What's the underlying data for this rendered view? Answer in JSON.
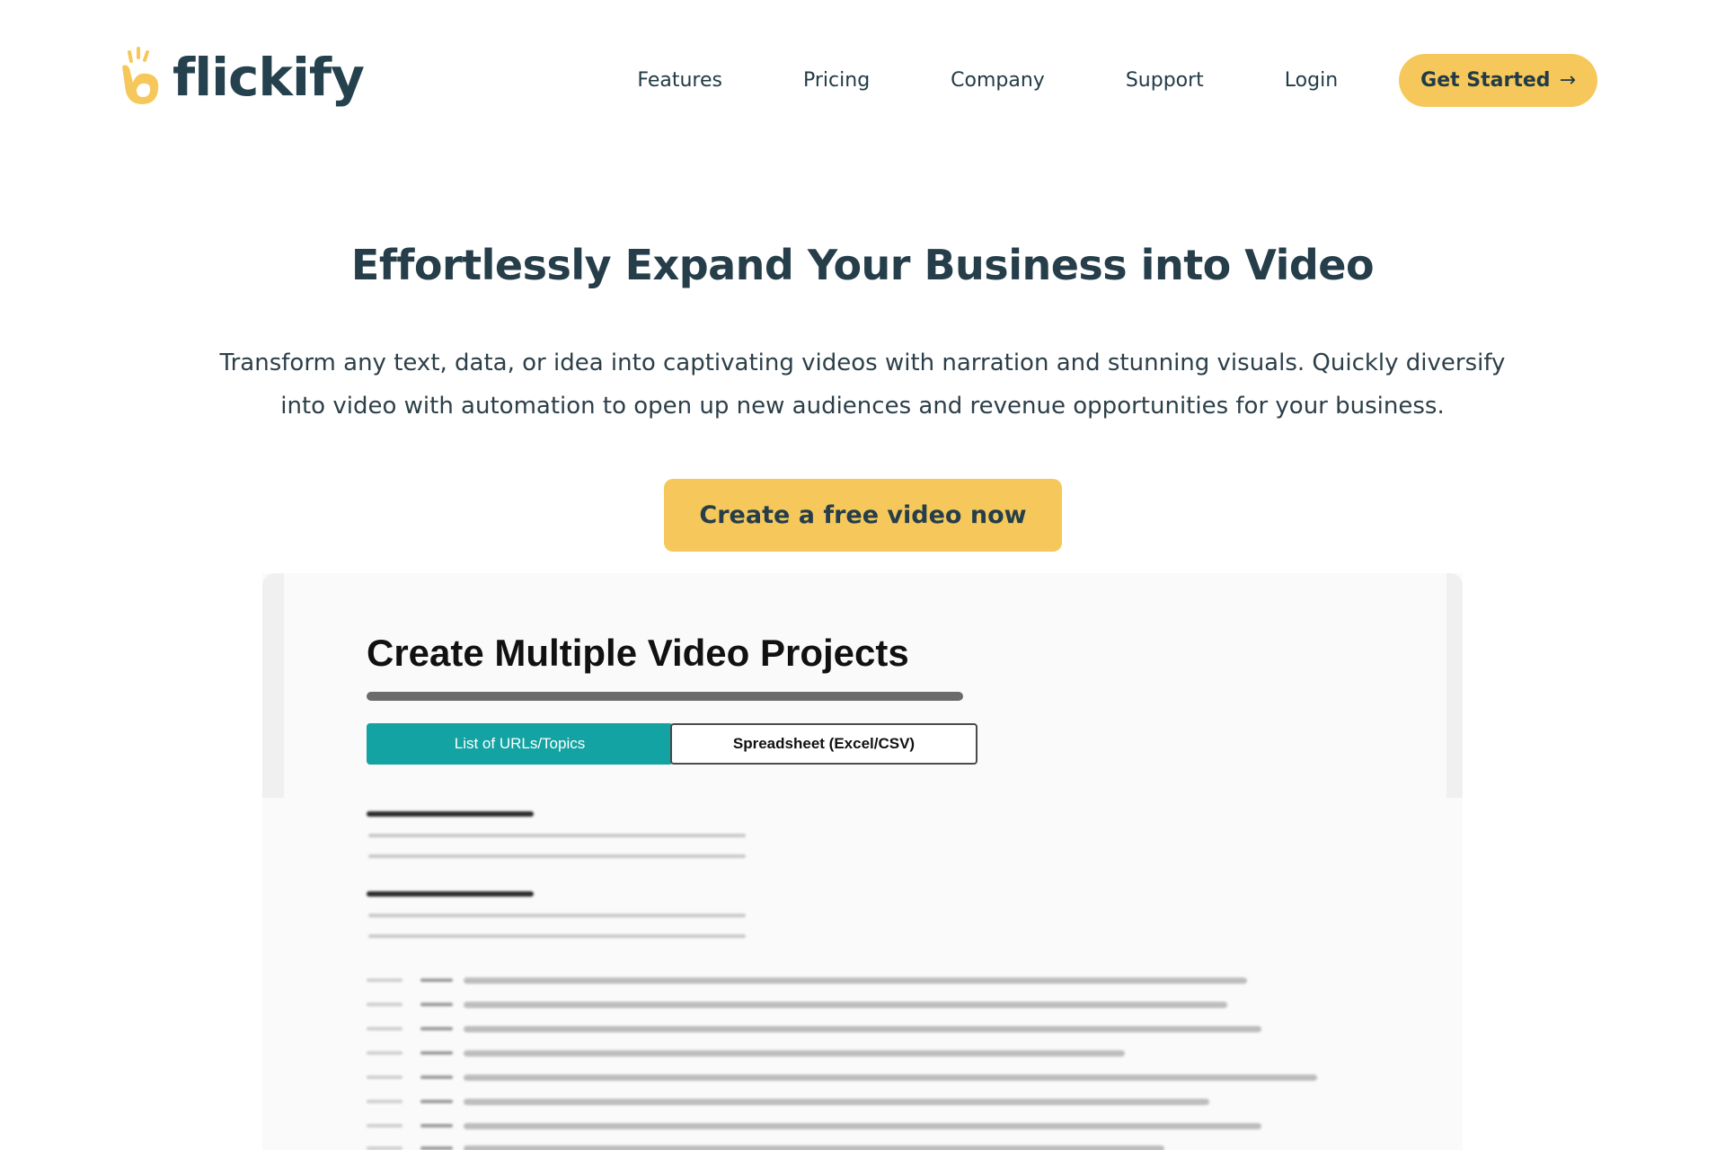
{
  "brand": {
    "name": "flickify",
    "accent": "#f6c85b",
    "text_color": "#253e4a"
  },
  "nav": {
    "links": [
      "Features",
      "Pricing",
      "Company",
      "Support",
      "Login"
    ],
    "cta_label": "Get Started",
    "cta_arrow": "→"
  },
  "hero": {
    "title": "Effortlessly Expand Your Business into Video",
    "subtitle_line1": "Transform any text, data, or idea into captivating videos with narration and stunning visuals.  Quickly diversify",
    "subtitle_line2": "into video with automation to open up new audiences and revenue opportunities for your business.",
    "cta_label": "Create a free video now"
  },
  "preview": {
    "title": "Create Multiple Video Projects",
    "tab_active": "List of URLs/Topics",
    "tab_inactive": "Spreadsheet (Excel/CSV)",
    "tab_active_color": "#13a3a3"
  }
}
